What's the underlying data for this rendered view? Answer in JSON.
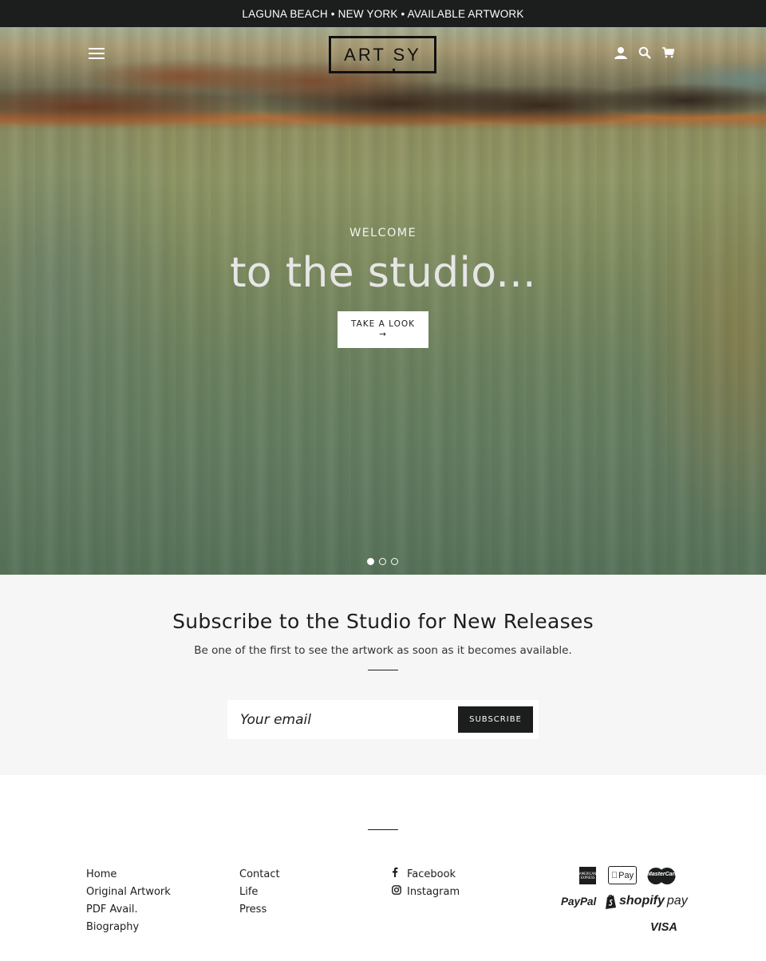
{
  "announcement": {
    "text": "LAGUNA BEACH • NEW YORK • AVAILABLE ARTWORK"
  },
  "header": {
    "logo_text": "ART SY",
    "icons": [
      "menu-icon",
      "account-icon",
      "search-icon",
      "cart-icon"
    ]
  },
  "hero": {
    "kicker": "WELCOME",
    "headline": "to the studio...",
    "cta_label": "TAKE A LOOK",
    "cta_arrow": "→",
    "slides": 3,
    "active_slide": 1
  },
  "newsletter": {
    "title": "Subscribe to the Studio for New Releases",
    "subtitle": "Be one of the first to see the artwork as soon as it becomes available.",
    "email_placeholder": "Your email",
    "button_label": "SUBSCRIBE"
  },
  "footer": {
    "col1": [
      "Home",
      "Original Artwork",
      "PDF Avail.",
      "Biography"
    ],
    "col2": [
      "Contact",
      "Life",
      "Press"
    ],
    "social": [
      {
        "label": "Facebook",
        "icon": "facebook-icon"
      },
      {
        "label": "Instagram",
        "icon": "instagram-icon"
      }
    ],
    "payments": {
      "amex": "AMERICAN EXPRESS",
      "apple_pay": "Pay",
      "mastercard": "MasterCard",
      "paypal": "PayPal",
      "shopify_pay_a": "shopify",
      "shopify_pay_b": "pay",
      "visa": "VISA"
    }
  },
  "colors": {
    "dark": "#1c1d1d",
    "newsletter_bg": "#f6f6f6",
    "white": "#ffffff"
  }
}
